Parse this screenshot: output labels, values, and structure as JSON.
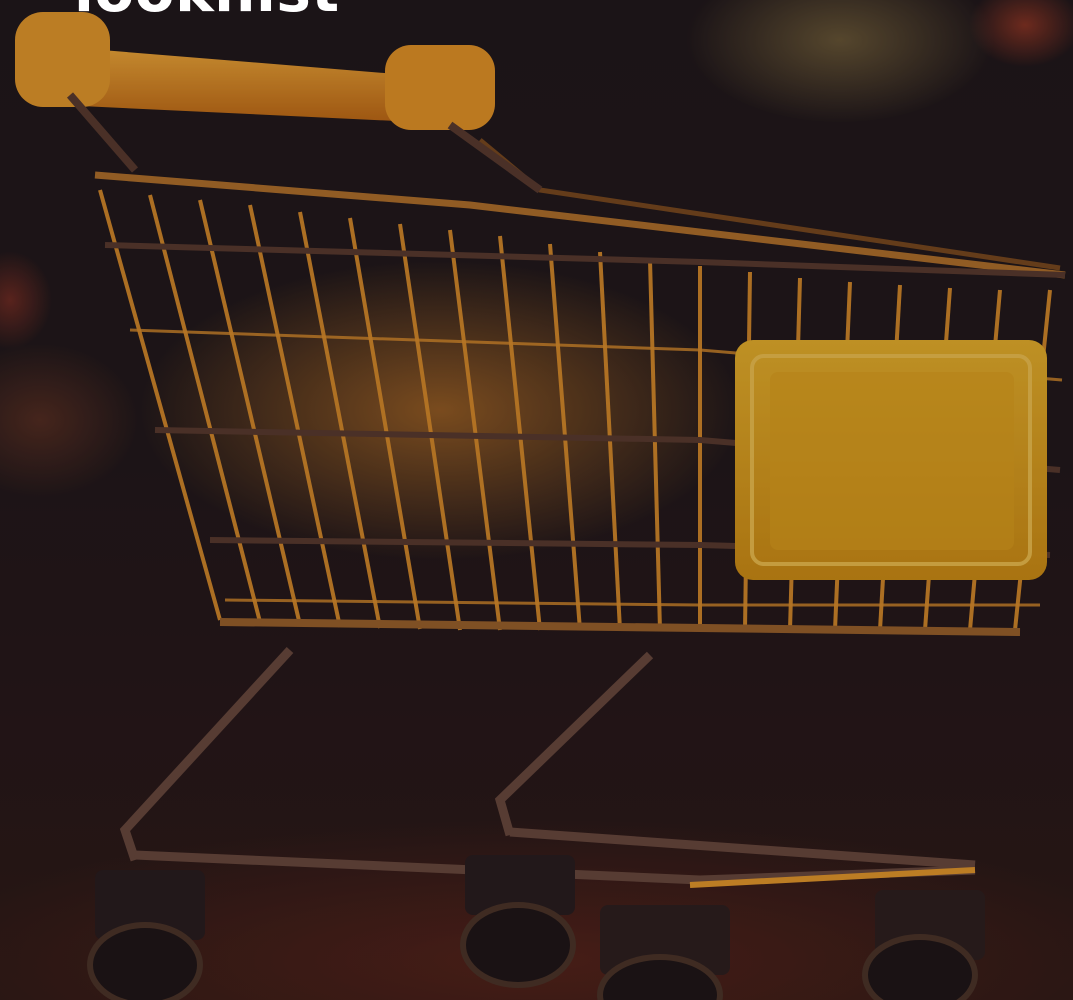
{
  "hero": {
    "headline": "lookhist"
  },
  "colors": {
    "accent": "#f5a623",
    "wire": "#e8952a",
    "sign": "#f1b01e",
    "overlay": "#1a1215"
  },
  "icons": {
    "main": "shopping-cart-icon"
  }
}
